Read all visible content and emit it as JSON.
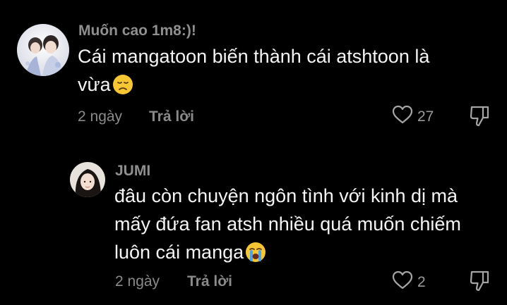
{
  "comments": [
    {
      "username": "Muốn cao 1m8:)!",
      "text_lines": [
        "Cái mangatoon biến thành cái atshtoon là",
        "vừa"
      ],
      "emoji": "disappointed-face",
      "time": "2 ngày",
      "reply_label": "Trả lời",
      "likes": "27"
    },
    {
      "username": "JUMI",
      "text_lines": [
        "đâu còn chuyện ngôn tình với kinh dị mà",
        "mấy đứa fan atsh nhiều quá muốn chiếm",
        "luôn cái manga"
      ],
      "emoji": "loudly-crying-face",
      "time": "2 ngày",
      "reply_label": "Trả lời",
      "likes": "2"
    }
  ],
  "colors": {
    "background": "#000000",
    "username": "#8f8f8f",
    "text": "#f4f4f4",
    "meta": "#8a8a8a"
  }
}
